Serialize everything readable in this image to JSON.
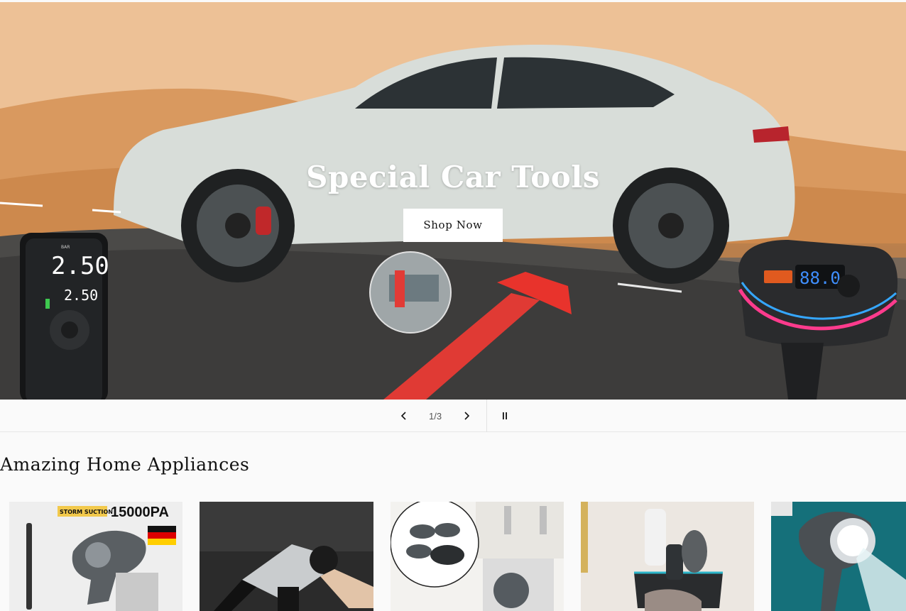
{
  "hero": {
    "title": "Special Car Tools",
    "button_label": "Shop Now",
    "pump_display_main": "2.50",
    "pump_display_sub": "2.50",
    "pump_unit": "BAR",
    "fm_display": "88.0"
  },
  "slider": {
    "current": "1",
    "separator": "/",
    "total": "3"
  },
  "collection": {
    "title": "Amazing Home Appliances",
    "card1_badge": "STORM SUCTION",
    "card1_value": "15000PA",
    "items": [
      {
        "name": "Cordless handheld vacuum"
      },
      {
        "name": "Car vacuum cleaner"
      },
      {
        "name": "Washing machine anti-vibration pads"
      },
      {
        "name": "Bathroom shaver organizer"
      },
      {
        "name": "High pressure shower head"
      }
    ]
  },
  "colors": {
    "background": "#fafafa",
    "text": "#121212",
    "button_bg": "#ffffff"
  }
}
